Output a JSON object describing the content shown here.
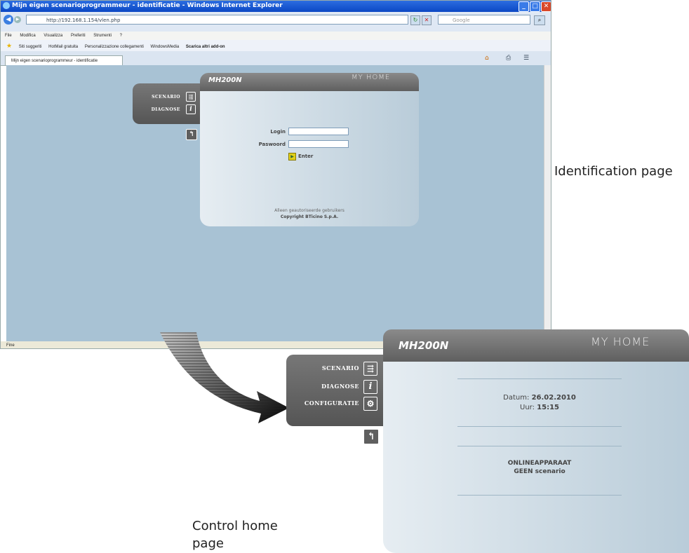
{
  "browser": {
    "title": "Mijn eigen scenarioprogrammeur - identificatie - Windows Internet Explorer",
    "url": "http://192.168.1.154/vlen.php",
    "search_placeholder": "Google",
    "menu": [
      "File",
      "Modifica",
      "Visualizza",
      "Preferiti",
      "Strumenti",
      "?"
    ],
    "favorites": [
      "Siti suggeriti",
      "HotMail gratuita",
      "Personalizzazione collegamenti",
      "WindowsMedia",
      "Scarica altri add-on"
    ],
    "tab_label": "Mijn eigen scenarioprogrammeur - identificatie",
    "status": "Fine"
  },
  "login_page": {
    "brand": "MH200N",
    "logo": "MY HOME",
    "menu": [
      {
        "label": "SCENARIO",
        "icon": "scenario-icon"
      },
      {
        "label": "DIAGNOSE",
        "icon": "info-icon"
      }
    ],
    "login_label": "Login",
    "password_label": "Paswoord",
    "enter_label": "Enter",
    "footer_line1": "Alleen geautoriseerde gebruikers",
    "footer_line2": "Copyright BTicino S.p.A."
  },
  "control_page": {
    "brand": "MH200N",
    "logo": "MY HOME",
    "menu": [
      {
        "label": "SCENARIO",
        "icon": "scenario-icon"
      },
      {
        "label": "DIAGNOSE",
        "icon": "info-icon"
      },
      {
        "label": "CONFIGURATIE",
        "icon": "settings-icon"
      }
    ],
    "date_label": "Datum:",
    "date_value": "26.02.2010",
    "time_label": "Uur:",
    "time_value": "15:15",
    "status_line1": "ONLINEAPPARAAT",
    "status_line2": "GEEN scenario"
  },
  "annotations": {
    "identification": "Identification page",
    "control": "Control home page"
  }
}
